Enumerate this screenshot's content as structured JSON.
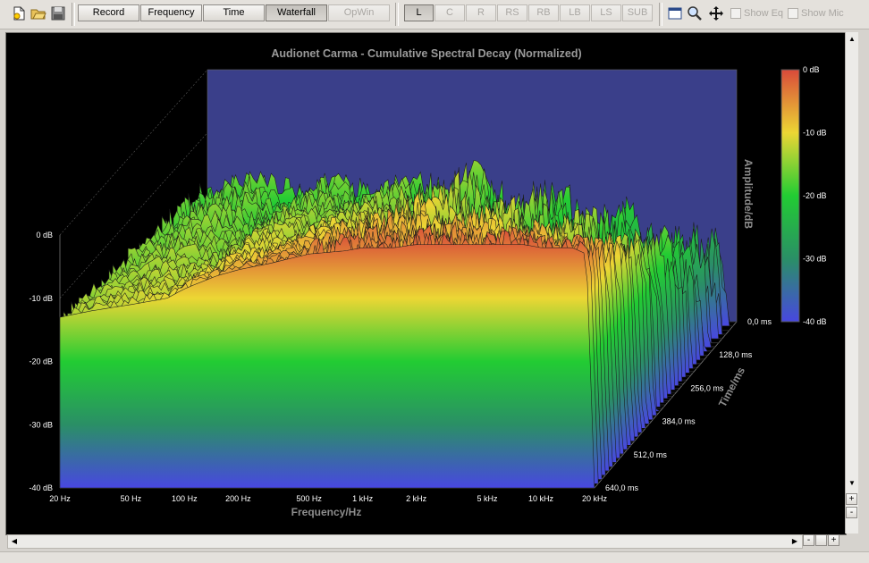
{
  "toolbar": {
    "file_icons": [
      "new-document-icon",
      "open-folder-icon",
      "save-disk-icon"
    ],
    "mode_buttons": [
      "Record",
      "Frequency",
      "Time",
      "Waterfall",
      "OpWin"
    ],
    "active_mode": "Waterfall",
    "channel_buttons": [
      "L",
      "C",
      "R",
      "RS",
      "RB",
      "LB",
      "LS",
      "SUB"
    ],
    "active_channel": "L",
    "view_icons": [
      "window-icon",
      "zoom-magnifier-icon",
      "pan-move-icon"
    ],
    "show_eq_label": "Show Eq",
    "show_mic_label": "Show Mic"
  },
  "colors": {
    "background": "#000000",
    "plot_back": "#3a3f8a",
    "scale_top": "#d94a3a",
    "scale_mid": "#ecd634",
    "scale_green": "#22cc33",
    "scale_bottom": "#4848e0"
  },
  "chart_data": {
    "type": "waterfall",
    "title": "Audionet Carma - Cumulative Spectral Decay (Normalized)",
    "xlabel": "Frequency/Hz",
    "ylabel": "Amplitude/dB",
    "zlabel": "Time/ms",
    "x_scale": "log",
    "x_ticks": [
      "20 Hz",
      "50 Hz",
      "100 Hz",
      "200 Hz",
      "500 Hz",
      "1 kHz",
      "2 kHz",
      "5 kHz",
      "10 kHz",
      "20 kHz"
    ],
    "x_tick_values": [
      20,
      50,
      100,
      200,
      500,
      1000,
      2000,
      5000,
      10000,
      20000
    ],
    "y_ticks": [
      "0 dB",
      "-10 dB",
      "-20 dB",
      "-30 dB",
      "-40 dB"
    ],
    "y_tick_values": [
      0,
      -10,
      -20,
      -30,
      -40
    ],
    "ylim": [
      -40,
      0
    ],
    "z_ticks": [
      "0,0 ms",
      "128,0 ms",
      "256,0 ms",
      "384,0 ms",
      "512,0 ms",
      "640,0 ms"
    ],
    "z_tick_values": [
      0,
      128,
      256,
      384,
      512,
      640
    ],
    "color_scale": {
      "labels": [
        "0 dB",
        "-10 dB",
        "-20 dB",
        "-30 dB",
        "-40 dB"
      ],
      "values": [
        0,
        -10,
        -20,
        -30,
        -40
      ]
    },
    "slice_count": 40,
    "first_slice": {
      "x": [
        20,
        30,
        50,
        80,
        100,
        150,
        200,
        300,
        500,
        800,
        1000,
        1500,
        2000,
        3000,
        5000,
        8000,
        10000,
        15000,
        18000,
        20000
      ],
      "y": [
        -13,
        -12,
        -11,
        -10,
        -8.5,
        -6.5,
        -5.5,
        -4.5,
        -3,
        -2.5,
        -2,
        -2,
        -1.5,
        -1.5,
        -1.5,
        -1.5,
        -2,
        -2,
        -3,
        -40
      ]
    }
  }
}
